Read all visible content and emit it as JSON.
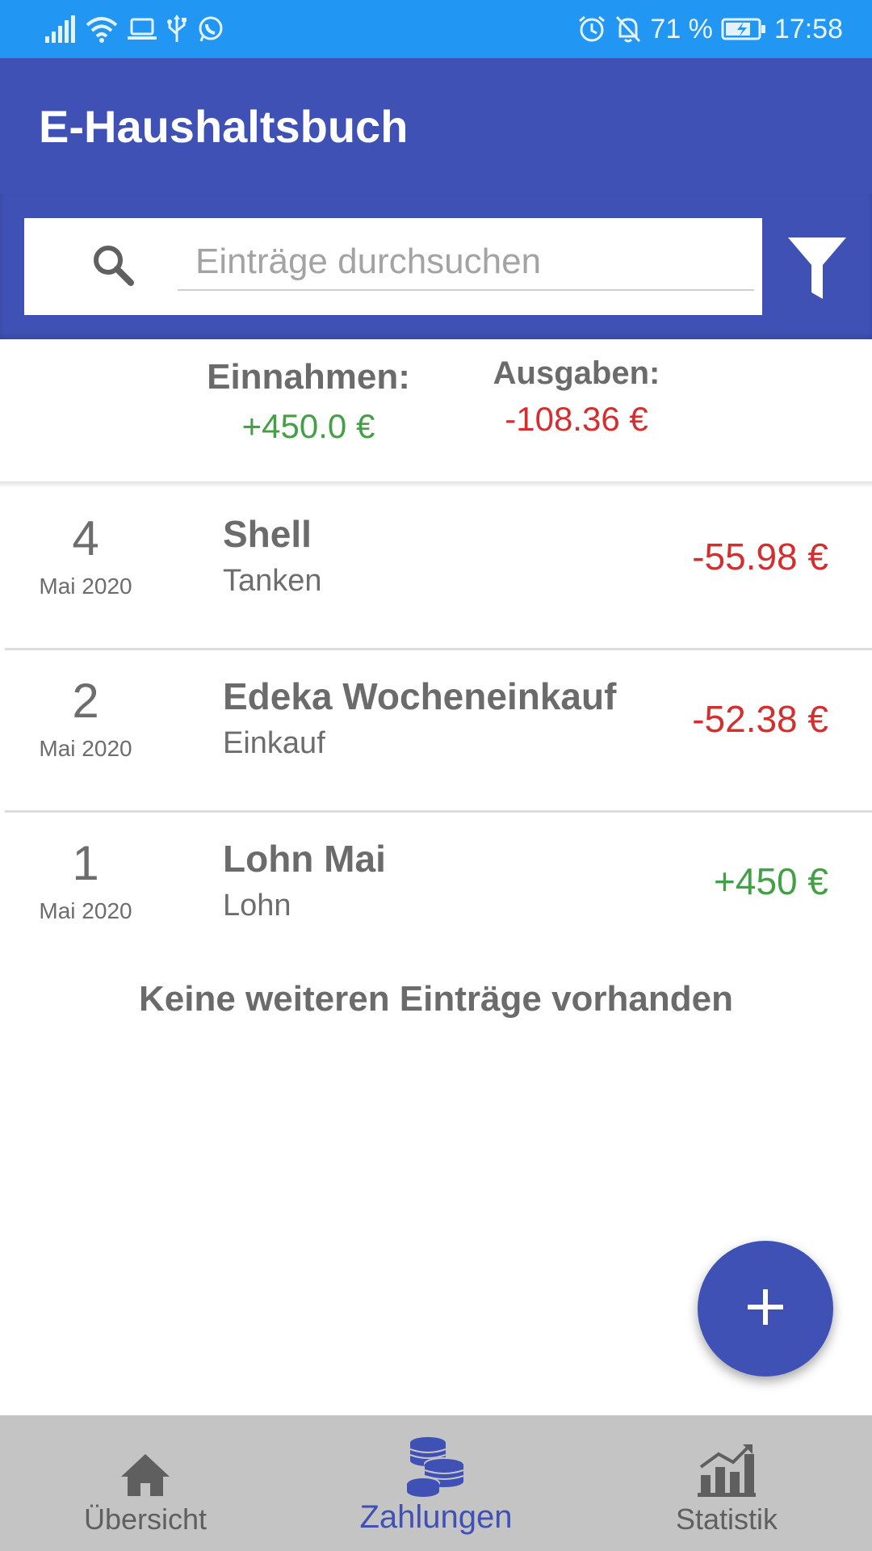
{
  "status_bar": {
    "battery_percent": "71 %",
    "time": "17:58",
    "left_icons": [
      "signal-icon",
      "wifi-icon",
      "laptop-icon",
      "usb-icon",
      "whatsapp-icon"
    ],
    "right_icons": [
      "alarm-icon",
      "bell-off-icon",
      "battery-charging-icon"
    ]
  },
  "app_bar": {
    "title": "E-Haushaltsbuch"
  },
  "search": {
    "placeholder": "Einträge durchsuchen",
    "value": ""
  },
  "summary": {
    "income_label": "Einnahmen:",
    "income_value": "+450.0 €",
    "expense_label": "Ausgaben:",
    "expense_value": "-108.36 €"
  },
  "entries": [
    {
      "day": "4",
      "month": "Mai 2020",
      "title": "Shell",
      "category": "Tanken",
      "amount": "-55.98 €",
      "type": "expense"
    },
    {
      "day": "2",
      "month": "Mai 2020",
      "title": "Edeka Wocheneinkauf",
      "category": "Einkauf",
      "amount": "-52.38 €",
      "type": "expense"
    },
    {
      "day": "1",
      "month": "Mai 2020",
      "title": "Lohn Mai",
      "category": "Lohn",
      "amount": "+450 €",
      "type": "income"
    }
  ],
  "end_message": "Keine weiteren Einträge vorhanden",
  "bottom_nav": {
    "items": [
      {
        "label": "Übersicht",
        "icon": "home-icon",
        "active": false
      },
      {
        "label": "Zahlungen",
        "icon": "coins-icon",
        "active": true
      },
      {
        "label": "Statistik",
        "icon": "chart-icon",
        "active": false
      }
    ]
  },
  "colors": {
    "status_bar": "#2196f3",
    "primary": "#3f51b5",
    "income": "#43a047",
    "expense": "#d32f2f",
    "nav_background": "#c4c4c4",
    "text_gray": "#6b6b6b"
  }
}
